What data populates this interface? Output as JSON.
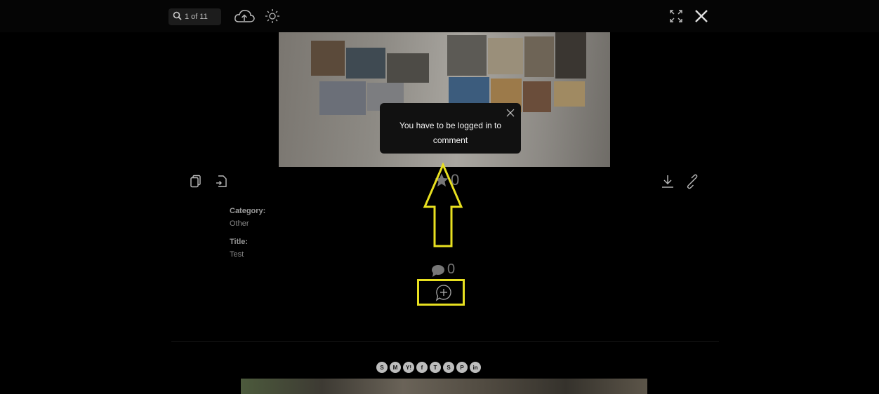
{
  "toolbar": {
    "search_counter": "1 of 11",
    "icons": [
      "search-icon",
      "cloud-upload-icon",
      "brightness-icon",
      "fullscreen-icon",
      "close-icon"
    ]
  },
  "tooltip": {
    "message": "You have to be logged in to comment"
  },
  "actions": {
    "left_icons": [
      "copy-icon",
      "file-export-icon"
    ],
    "right_icons": [
      "download-icon",
      "link-icon"
    ]
  },
  "rating": {
    "count": "0"
  },
  "details": {
    "category_label": "Category:",
    "category_value": "Other",
    "title_label": "Title:",
    "title_value": "Test"
  },
  "comments": {
    "count": "0"
  },
  "share": {
    "icons": [
      "S",
      "M",
      "Y!",
      "f",
      "T",
      "S",
      "P",
      "in"
    ]
  },
  "colors": {
    "highlight": "#e8e020",
    "tooltip_bg": "#111111",
    "page_bg": "#000000"
  }
}
